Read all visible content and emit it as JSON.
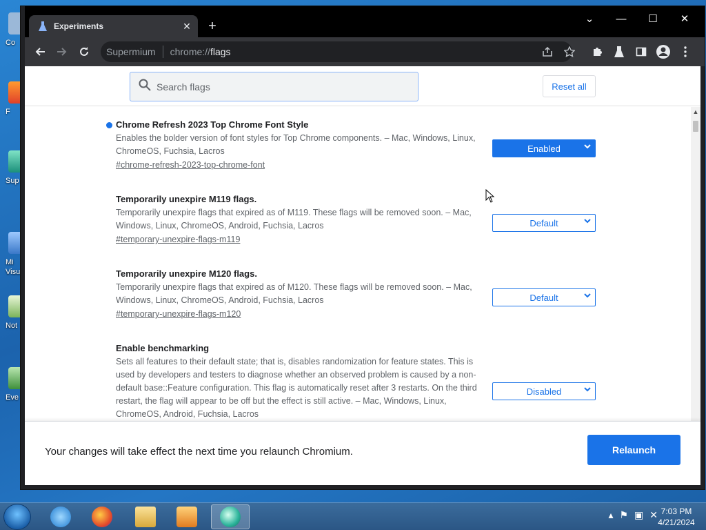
{
  "desktop": {
    "icons": [
      {
        "label": "Co"
      },
      {
        "label": "F"
      },
      {
        "label": "Sup"
      },
      {
        "label": "Mi"
      },
      {
        "label": "Visu"
      },
      {
        "label": "Not"
      },
      {
        "label": "Eve"
      }
    ]
  },
  "browser": {
    "tab_title": "Experiments",
    "tab_close": "✕",
    "new_tab": "+",
    "window_controls": {
      "minimize": "—",
      "maximize": "☐",
      "close": "✕",
      "tab_search": "⌄"
    },
    "omnibox": {
      "site": "Supermium",
      "url_scheme": "chrome://",
      "url_path": "flags"
    }
  },
  "flags_page": {
    "search": {
      "placeholder": "Search flags",
      "value": ""
    },
    "reset_all": "Reset all",
    "flags": [
      {
        "name": "Chrome Refresh 2023 Top Chrome Font Style",
        "description": "Enables the bolder version of font styles for Top Chrome components. – Mac, Windows, Linux, ChromeOS, Fuchsia, Lacros",
        "link": "#chrome-refresh-2023-top-chrome-font",
        "state": "Enabled",
        "modified": true
      },
      {
        "name": "Temporarily unexpire M119 flags.",
        "description": "Temporarily unexpire flags that expired as of M119. These flags will be removed soon. – Mac, Windows, Linux, ChromeOS, Android, Fuchsia, Lacros",
        "link": "#temporary-unexpire-flags-m119",
        "state": "Default",
        "modified": false
      },
      {
        "name": "Temporarily unexpire M120 flags.",
        "description": "Temporarily unexpire flags that expired as of M120. These flags will be removed soon. – Mac, Windows, Linux, ChromeOS, Android, Fuchsia, Lacros",
        "link": "#temporary-unexpire-flags-m120",
        "state": "Default",
        "modified": false
      },
      {
        "name": "Enable benchmarking",
        "description": "Sets all features to their default state; that is, disables randomization for feature states. This is used by developers and testers to diagnose whether an observed problem is caused by a non-default base::Feature configuration. This flag is automatically reset after 3 restarts. On the third restart, the flag will appear to be off but the effect is still active. – Mac, Windows, Linux, ChromeOS, Android, Fuchsia, Lacros",
        "link": "",
        "state": "Disabled",
        "modified": false
      }
    ],
    "footer": {
      "message": "Your changes will take effect the next time you relaunch Chromium.",
      "relaunch": "Relaunch"
    }
  },
  "taskbar": {
    "clock_time": "7:03 PM",
    "clock_date": "4/21/2024",
    "pinned": [
      "internet-explorer",
      "firefox",
      "file-explorer",
      "media-player",
      "supermium"
    ]
  },
  "colors": {
    "accent": "#1a73e8",
    "toolbar": "#35363a",
    "titlebar": "#000000"
  }
}
